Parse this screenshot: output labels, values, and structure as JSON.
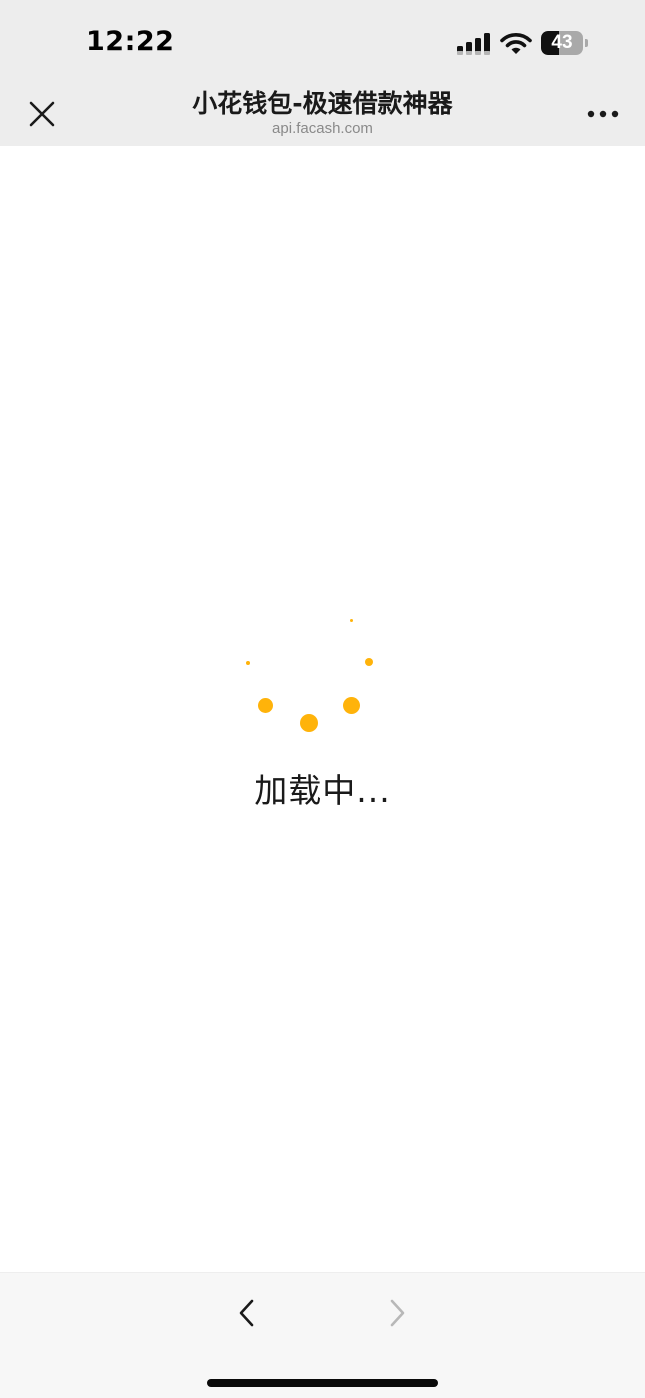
{
  "status_bar": {
    "time": "12:22",
    "battery_level": "43",
    "battery_fraction": 0.43,
    "icons": [
      "cellular-signal-icon",
      "wifi-icon",
      "battery-icon"
    ]
  },
  "nav_bar": {
    "title": "小花钱包-极速借款神器",
    "subtitle": "api.facash.com",
    "icons": [
      "close-icon",
      "more-dots-icon"
    ]
  },
  "content": {
    "loading_text": "加载中...",
    "spinner_color": "#ffb30a"
  },
  "toolbar": {
    "icons": [
      "chevron-left-icon",
      "chevron-right-icon"
    ],
    "back_enabled": true,
    "forward_enabled": false
  }
}
